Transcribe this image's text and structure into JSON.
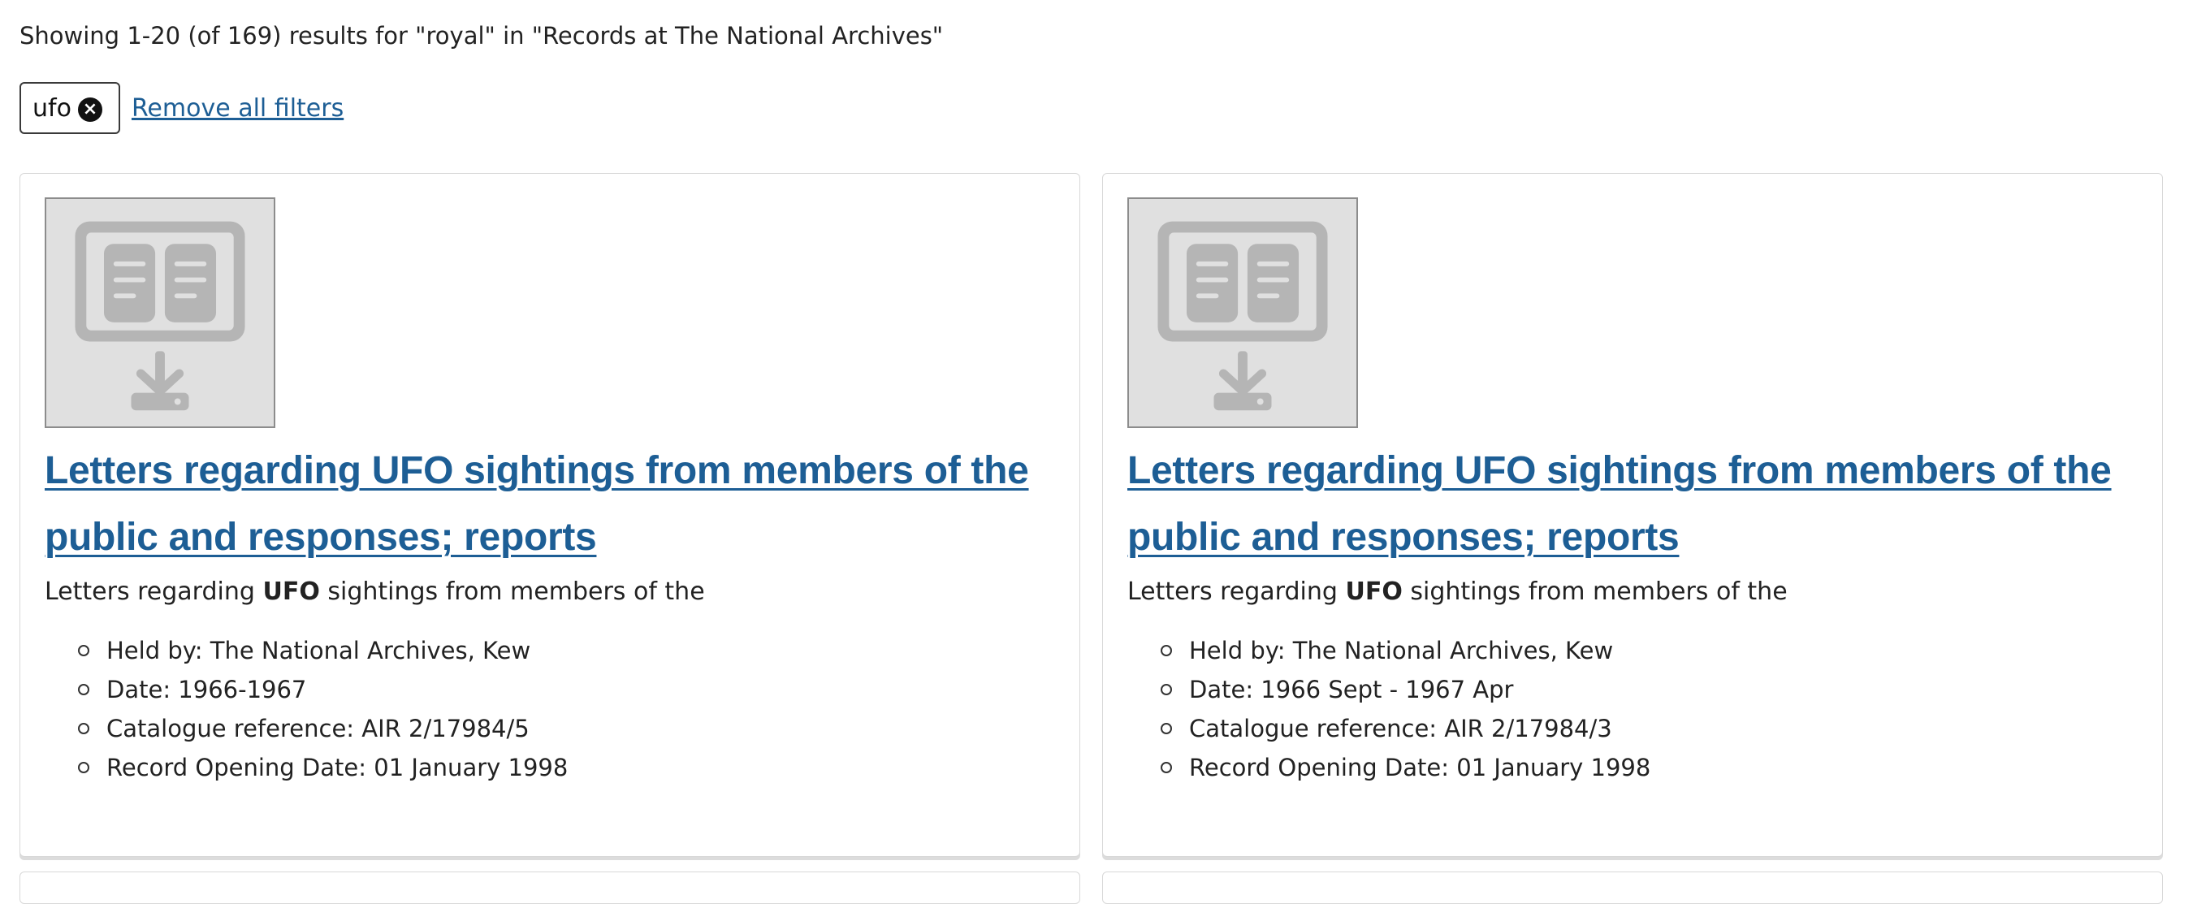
{
  "summary": {
    "text": "Showing 1-20 (of 169) results for \"royal\" in \"Records at The National Archives\""
  },
  "filters": {
    "active": [
      {
        "label": "ufo",
        "remove_icon": "close-circle-icon"
      }
    ],
    "remove_all_label": "Remove all filters"
  },
  "results": [
    {
      "thumbnail_icon": "digital-document-download-icon",
      "title": "Letters regarding UFO sightings from members of the public and responses; reports",
      "snippet_before": "Letters regarding ",
      "snippet_highlight": "UFO",
      "snippet_after": " sightings from members of the",
      "meta": [
        "Held by: The National Archives, Kew",
        "Date: 1966-1967",
        "Catalogue reference: AIR 2/17984/5",
        "Record Opening Date: 01 January 1998"
      ]
    },
    {
      "thumbnail_icon": "digital-document-download-icon",
      "title": "Letters regarding UFO sightings from members of the public and responses; reports",
      "snippet_before": "Letters regarding ",
      "snippet_highlight": "UFO",
      "snippet_after": " sightings from members of the",
      "meta": [
        "Held by: The National Archives, Kew",
        "Date: 1966 Sept - 1967 Apr",
        "Catalogue reference: AIR 2/17984/3",
        "Record Opening Date: 01 January 1998"
      ]
    }
  ],
  "colors": {
    "link": "#1d5e95",
    "text": "#222222",
    "thumbnail_bg": "#e0e0e0",
    "thumbnail_icon": "#b5b5b5"
  }
}
